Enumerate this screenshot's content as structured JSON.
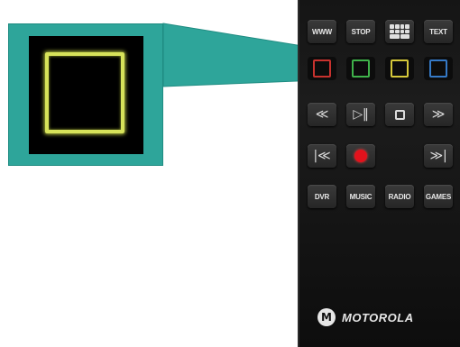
{
  "remote": {
    "row1": {
      "www": "WWW",
      "stop": "STOP",
      "grid_icon": "guide-grid-icon",
      "text": "TEXT"
    },
    "color_keys": [
      {
        "name": "red",
        "color": "#c8322e"
      },
      {
        "name": "green",
        "color": "#3fb24a"
      },
      {
        "name": "yellow",
        "color": "#d6c93a"
      },
      {
        "name": "blue",
        "color": "#3579c6"
      }
    ],
    "transport": {
      "rewind": "≪",
      "play_pause": "▷‖",
      "stop_icon": "stop-icon",
      "fast_forward": "≫",
      "skip_back": "|≪",
      "record_icon": "record-icon",
      "skip_forward": "≫|"
    },
    "row5": {
      "dvr": "DVR",
      "music": "MUSIC",
      "radio": "RADIO",
      "games": "GAMES"
    },
    "brand": {
      "logo": "M",
      "name": "MOTOROLA"
    }
  },
  "callout": {
    "highlighted_key": "yellow",
    "accent": "#2ea59a",
    "square_color": "#d7e35a"
  }
}
